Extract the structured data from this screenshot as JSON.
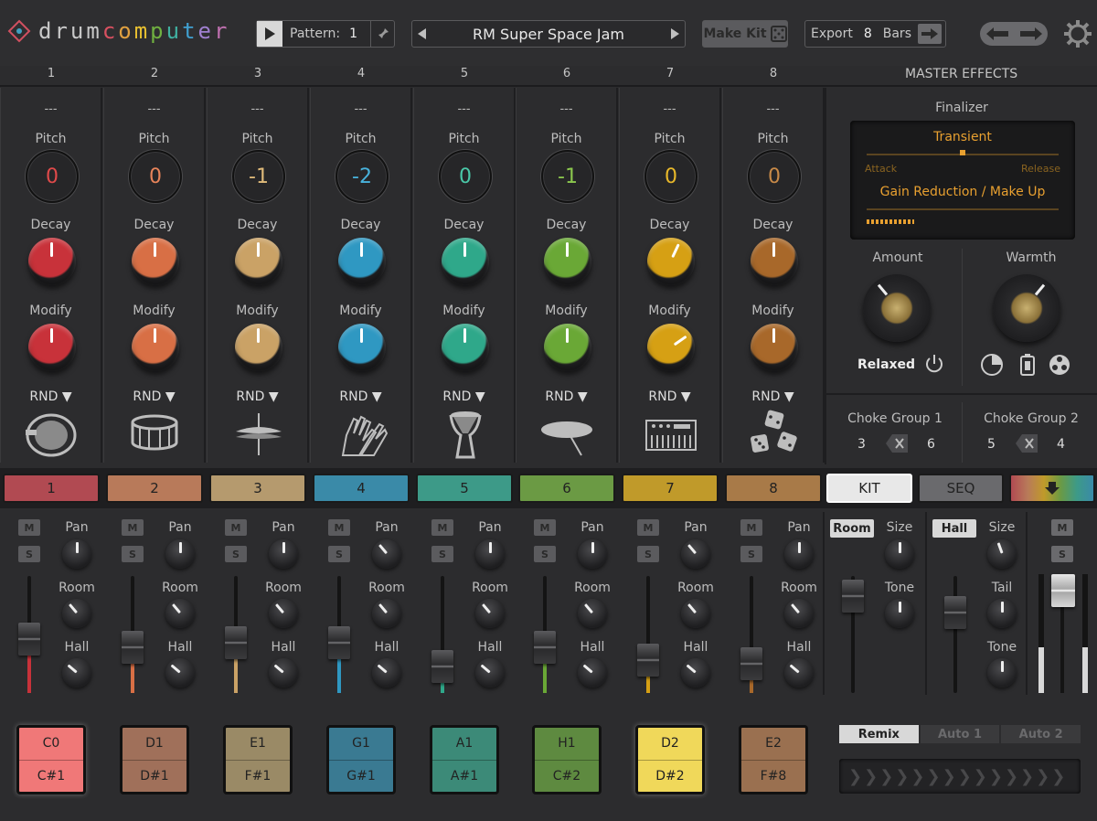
{
  "header": {
    "logo": "drumcomputer",
    "pattern_label": "Pattern:",
    "pattern_value": "1",
    "kit_name": "RM Super Space Jam",
    "make_kit_label": "Make Kit",
    "export_label": "Export",
    "export_bars_value": "8",
    "bars_label": "Bars"
  },
  "columns": [
    "1",
    "2",
    "3",
    "4",
    "5",
    "6",
    "7",
    "8"
  ],
  "master_effects_label": "MASTER EFFECTS",
  "channels": [
    {
      "name": "---",
      "pitch": "0",
      "color": "#c8323a",
      "pitch_color": "#e04a4a",
      "decay_angle": 0,
      "modify_angle": 0,
      "instrument": "kick-drum-icon"
    },
    {
      "name": "---",
      "pitch": "0",
      "color": "#d86f45",
      "pitch_color": "#e8845a",
      "decay_angle": 0,
      "modify_angle": 0,
      "instrument": "snare-drum-icon"
    },
    {
      "name": "---",
      "pitch": "-1",
      "color": "#caa266",
      "pitch_color": "#e0bb7a",
      "decay_angle": 0,
      "modify_angle": 0,
      "instrument": "hihat-icon"
    },
    {
      "name": "---",
      "pitch": "-2",
      "color": "#2f98c2",
      "pitch_color": "#48b2dc",
      "decay_angle": 0,
      "modify_angle": 0,
      "instrument": "clap-hands-icon"
    },
    {
      "name": "---",
      "pitch": "0",
      "color": "#2fa88a",
      "pitch_color": "#4ac8a8",
      "decay_angle": 0,
      "modify_angle": 0,
      "instrument": "djembe-icon"
    },
    {
      "name": "---",
      "pitch": "-1",
      "color": "#6aa836",
      "pitch_color": "#8cc84e",
      "decay_angle": 0,
      "modify_angle": 0,
      "instrument": "cymbal-icon"
    },
    {
      "name": "---",
      "pitch": "0",
      "color": "#d6a014",
      "pitch_color": "#e8b82a",
      "decay_angle": 25,
      "modify_angle": 55,
      "instrument": "synth-keyboard-icon"
    },
    {
      "name": "---",
      "pitch": "0",
      "color": "#a8682a",
      "pitch_color": "#c88a48",
      "decay_angle": 0,
      "modify_angle": 0,
      "instrument": "dice-icon"
    }
  ],
  "labels": {
    "pitch": "Pitch",
    "decay": "Decay",
    "modify": "Modify",
    "rnd": "RND"
  },
  "finalizer": {
    "title": "Finalizer",
    "transient": "Transient",
    "attack": "Attack",
    "release": "Release",
    "gain_reduction": "Gain Reduction / Make Up",
    "amount": "Amount",
    "warmth": "Warmth",
    "mode": "Relaxed"
  },
  "choke": {
    "group1_label": "Choke Group 1",
    "group1_a": "3",
    "group1_b": "6",
    "group2_label": "Choke Group 2",
    "group2_a": "5",
    "group2_b": "4"
  },
  "pad_tabs": [
    "1",
    "2",
    "3",
    "4",
    "5",
    "6",
    "7",
    "8"
  ],
  "pad_tab_colors": [
    "#b14a52",
    "#b87a5a",
    "#b59a6e",
    "#3a8aa8",
    "#3d9a88",
    "#6b9a44",
    "#c09a2a",
    "#a87a48"
  ],
  "view_tabs": {
    "kit": "KIT",
    "seq": "SEQ"
  },
  "mixer": {
    "mute": "M",
    "solo": "S",
    "pan": "Pan",
    "room": "Room",
    "hall": "Hall",
    "fader_levels": [
      0.45,
      0.35,
      0.4,
      0.4,
      0.12,
      0.35,
      0.2,
      0.15
    ],
    "pan_angles": [
      0,
      0,
      0,
      -40,
      0,
      0,
      -40,
      0
    ],
    "room_angles": [
      -40,
      -40,
      -40,
      -40,
      -40,
      -40,
      -40,
      -40
    ],
    "hall_angles": [
      -50,
      -50,
      -50,
      -50,
      -50,
      -50,
      -50,
      -50
    ]
  },
  "reverb_room": {
    "label": "Room",
    "size": "Size",
    "tone": "Tone"
  },
  "reverb_hall": {
    "label": "Hall",
    "size": "Size",
    "tail": "Tail",
    "tone": "Tone"
  },
  "notes": [
    {
      "top": "C0",
      "bottom": "C#1",
      "color": "#f07878",
      "active": true
    },
    {
      "top": "D1",
      "bottom": "D#1",
      "color": "#a0705a",
      "active": false
    },
    {
      "top": "E1",
      "bottom": "F#1",
      "color": "#9a8a66",
      "active": false
    },
    {
      "top": "G1",
      "bottom": "G#1",
      "color": "#3a7a92",
      "active": false
    },
    {
      "top": "A1",
      "bottom": "A#1",
      "color": "#3c8a78",
      "active": false
    },
    {
      "top": "H1",
      "bottom": "C#2",
      "color": "#5e8a40",
      "active": false
    },
    {
      "top": "D2",
      "bottom": "D#2",
      "color": "#f0d85a",
      "active": true
    },
    {
      "top": "E2",
      "bottom": "F#8",
      "color": "#9a7050",
      "active": false
    }
  ],
  "remix_tabs": [
    "Remix",
    "Auto 1",
    "Auto 2"
  ]
}
